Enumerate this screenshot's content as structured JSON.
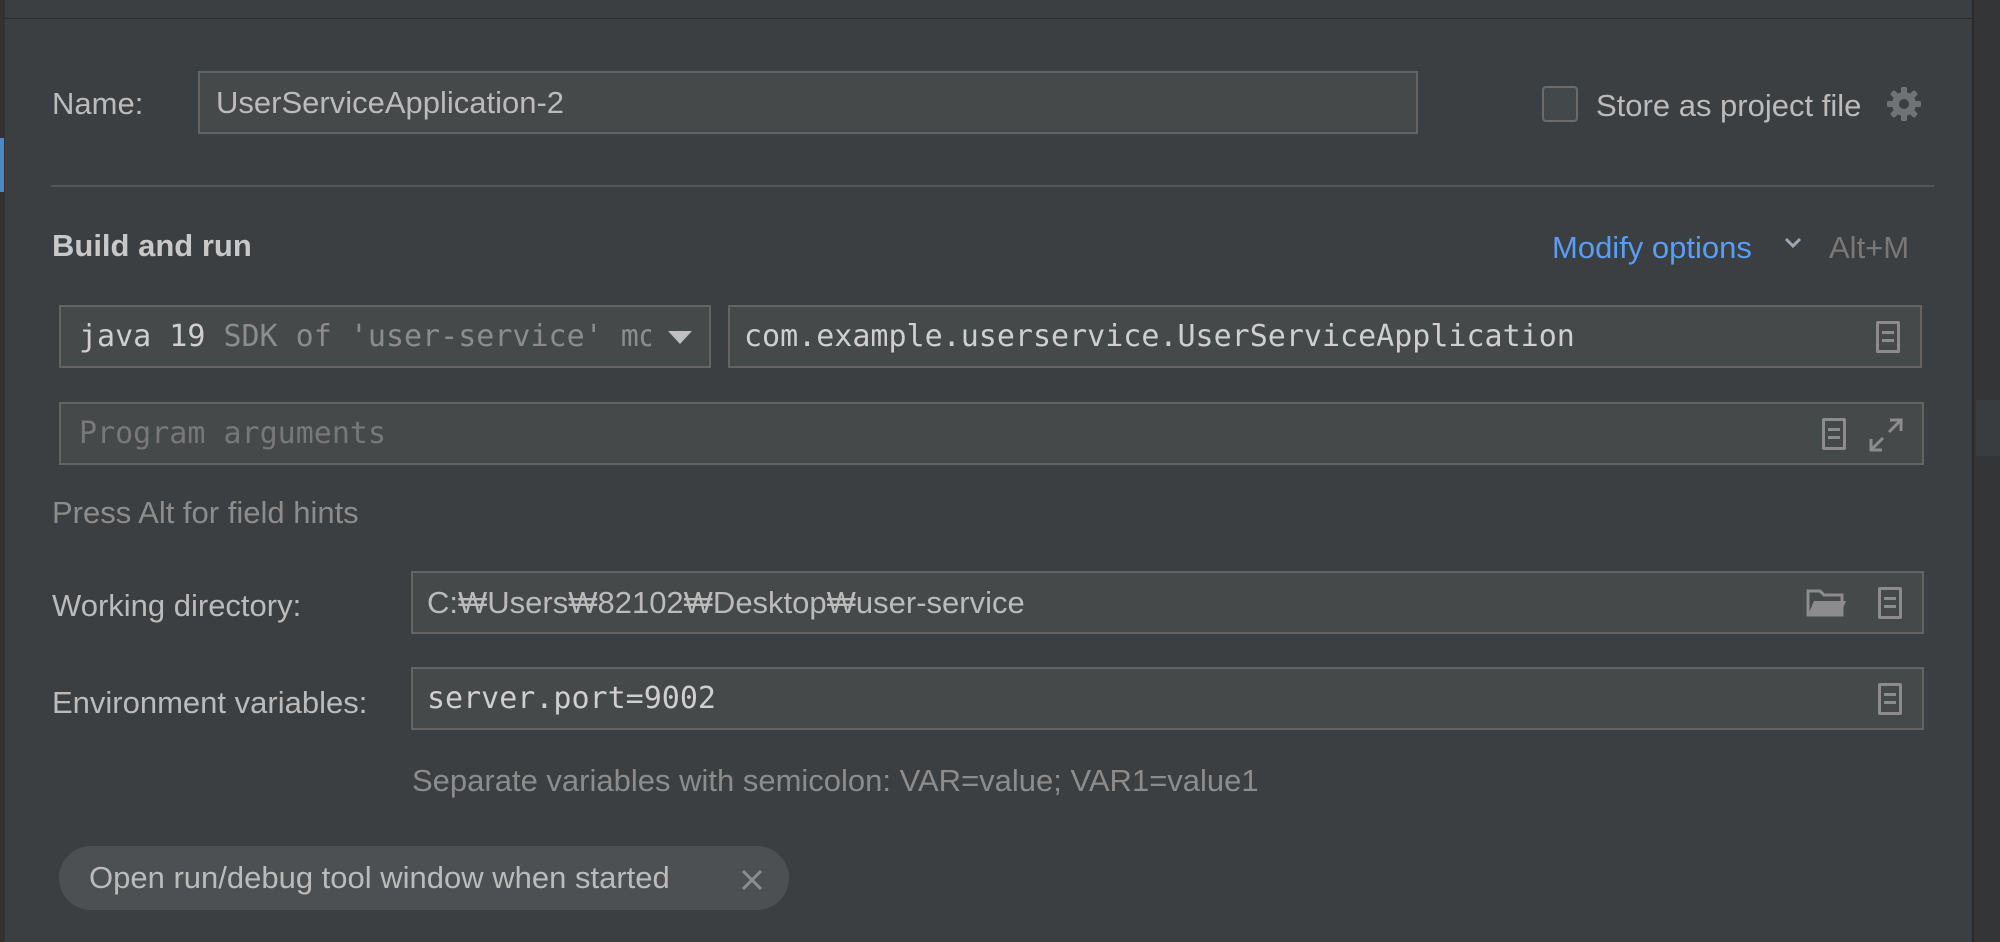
{
  "name_row": {
    "label": "Name:",
    "value": "UserServiceApplication-2",
    "store_label": "Store as project file",
    "store_checked": false
  },
  "build_run": {
    "heading": "Build and run",
    "modify_options": "Modify options",
    "modify_shortcut": "Alt+M",
    "jdk_main": "java 19",
    "jdk_hint": "SDK of 'user-service' mo",
    "main_class": "com.example.userservice.UserServiceApplication",
    "program_args_placeholder": "Program arguments",
    "field_hint": "Press Alt for field hints"
  },
  "working_dir": {
    "label": "Working directory:",
    "value": "C:₩Users₩82102₩Desktop₩user-service"
  },
  "env_vars": {
    "label": "Environment variables:",
    "value": "server.port=9002",
    "hint": "Separate variables with semicolon: VAR=value; VAR1=value1"
  },
  "options": {
    "tag_label": "Open run/debug tool window when started"
  },
  "icons": {
    "gear": "gear-icon",
    "chevron": "chevron-down-icon",
    "dropdown": "dropdown-arrow-icon",
    "document": "document-icon",
    "expand": "expand-icon",
    "folder": "folder-icon",
    "close": "close-icon"
  },
  "colors": {
    "background": "#3c3f41",
    "field_bg": "#45494a",
    "field_border": "#646464",
    "link": "#589df6",
    "text": "#bbbbbb",
    "muted": "#8c8c8c"
  }
}
